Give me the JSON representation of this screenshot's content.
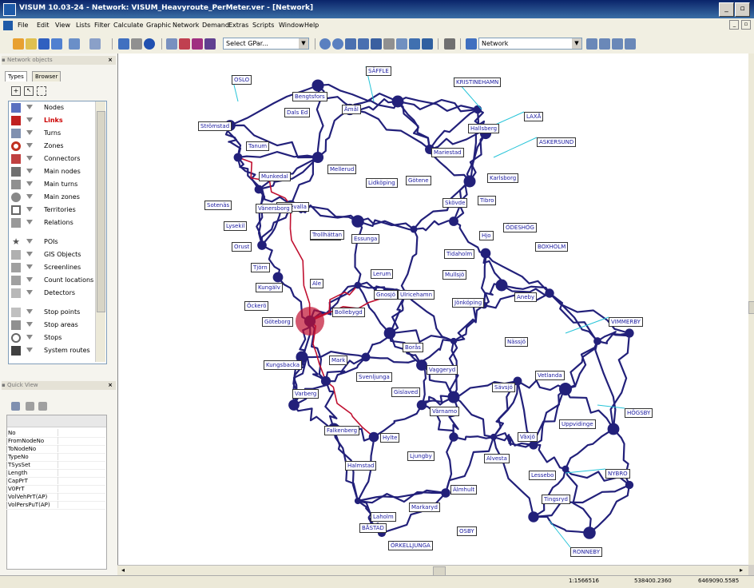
{
  "window": {
    "title": "VISUM 10.03-24 - Network: VISUM_Heavyroute_PerMeter.ver - [Network]"
  },
  "menu": [
    "File",
    "Edit",
    "View",
    "Lists",
    "Filter",
    "Calculate",
    "Graphic",
    "Network",
    "Demand",
    "Extras",
    "Scripts",
    "Window",
    "Help"
  ],
  "toolbar": {
    "gpar_combo": "Select GPar...",
    "view_combo": "Network"
  },
  "network_objects": {
    "header": "Network objects",
    "tabs": [
      "Types",
      "Browser"
    ],
    "items": [
      "Nodes",
      "Links",
      "Turns",
      "Zones",
      "Connectors",
      "Main nodes",
      "Main turns",
      "Main zones",
      "Territories",
      "Relations",
      "POIs",
      "GIS Objects",
      "Screenlines",
      "Count locations",
      "Detectors",
      "Stop points",
      "Stop areas",
      "Stops",
      "System routes"
    ],
    "selected": "Links"
  },
  "quick_view": {
    "header": "Quick View",
    "rows": [
      "No",
      "FromNodeNo",
      "ToNodeNo",
      "TypeNo",
      "TSysSet",
      "Length",
      "CapPrT",
      "V0PrT",
      "VolVehPrT(AP)",
      "VolPersPuT(AP)"
    ]
  },
  "map": {
    "cities": [
      "OSLO",
      "SÄFFLE",
      "KRISTINEHAMN",
      "Bengtsfors",
      "Åmål",
      "Dals Ed",
      "LAXÅ",
      "Strömstad",
      "Hallsberg",
      "ASKERSUND",
      "Tanum",
      "Mariestad",
      "Munkedal",
      "Mellerud",
      "Karlsborg",
      "Lidköping",
      "Götene",
      "Sotenäs",
      "Uddevalla",
      "Skövde",
      "Tibro",
      "Lysekil",
      "Vänersborg",
      "Falköping",
      "Hjo",
      "ÖDESHÖG",
      "Orust",
      "Trollhättan",
      "Essunga",
      "BOXHOLM",
      "Tidaholm",
      "Tjörn",
      "Kungälv",
      "Lerum",
      "Mullsjö",
      "Öckerö",
      "Ale",
      "Ulricehamn",
      "Jönköping",
      "Gnosjö",
      "Aneby",
      "Göteborg",
      "Bollebygd",
      "VIMMERBY",
      "Borås",
      "Nässjö",
      "Kungsbacka",
      "Mark",
      "Svenljunga",
      "Vaggeryd",
      "Vetlanda",
      "Varberg",
      "Gislaved",
      "Sävsjö",
      "Falkenberg",
      "Värnamo",
      "HÖGSBY",
      "Uppvidinge",
      "Hylte",
      "Växjö",
      "Halmstad",
      "Ljungby",
      "Alvesta",
      "NYBRO",
      "Lessebo",
      "Älmhult",
      "Markaryd",
      "Tingsryd",
      "Laholm",
      "BÅSTAD",
      "OSBY",
      "ÖRKELLJUNGA",
      "RONNEBY"
    ]
  },
  "status": {
    "scale": "1:1566516",
    "x": "538400.2360",
    "y": "6469090.5585"
  },
  "colors": {
    "links": "#22207a",
    "heavy": "#c01030",
    "connectors": "#26c4d8",
    "selected_label": "#cc0000"
  }
}
